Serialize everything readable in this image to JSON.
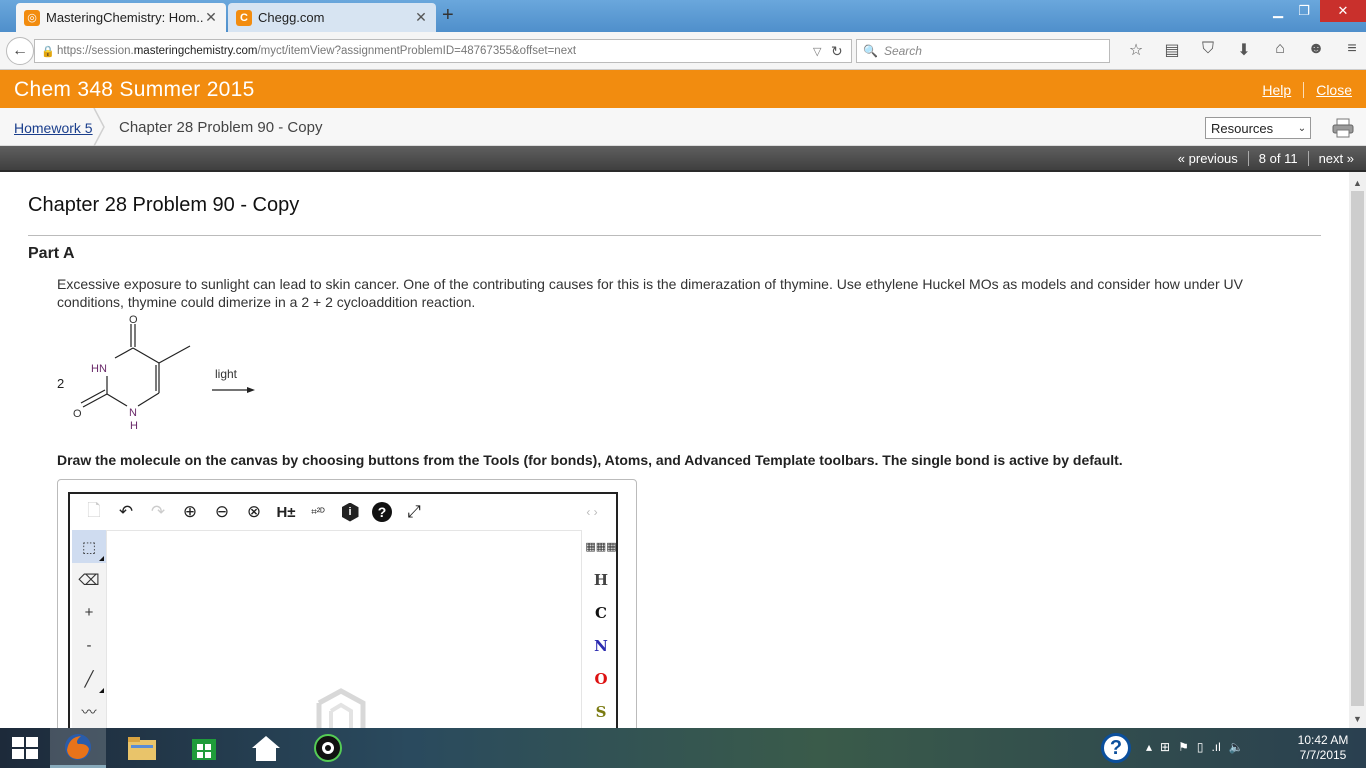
{
  "browser": {
    "tabs": [
      {
        "title": "MasteringChemistry: Hom...",
        "active": true,
        "favicon_color": "#f28c0f"
      },
      {
        "title": "Chegg.com",
        "active": false,
        "favicon_color": "#f28c0f",
        "favicon_letter": "C"
      }
    ],
    "url_prefix": "https://session.",
    "url_domain": "masteringchemistry.com",
    "url_suffix": "/myct/itemView?assignmentProblemID=48767355&offset=next",
    "search_placeholder": "Search"
  },
  "course": {
    "title": "Chem 348 Summer 2015",
    "help_label": "Help",
    "close_label": "Close",
    "accent_color": "#f28c0f"
  },
  "breadcrumb": {
    "home": "Homework 5",
    "current": "Chapter 28 Problem 90 - Copy"
  },
  "resources": {
    "selected": "Resources"
  },
  "pager": {
    "previous": "« previous",
    "position": "8 of 11",
    "next": "next »"
  },
  "problem": {
    "title": "Chapter 28 Problem 90 - Copy",
    "part": "Part A",
    "question": "Excessive exposure to sunlight can lead to skin cancer.  One of the contributing causes for this is the dimerazation of thymine.  Use ethylene Huckel MOs as models and consider how under UV conditions, thymine could dimerize in a 2 + 2 cycloaddition reaction.",
    "molecule": {
      "coefficient": "2",
      "atom_O_top": "O",
      "atom_HN": "HN",
      "atom_N": "N",
      "atom_H": "H",
      "atom_O_left": "O",
      "arrow_label": "light"
    },
    "instruction": "Draw the molecule on the canvas by choosing buttons from the Tools (for bonds), Atoms, and Advanced Template toolbars. The single bond is active by default."
  },
  "editor": {
    "top_tools": [
      {
        "name": "new-document-icon",
        "glyph": "🗋",
        "disabled": true
      },
      {
        "name": "undo-icon",
        "glyph": "↶",
        "disabled": false
      },
      {
        "name": "redo-icon",
        "glyph": "↷",
        "disabled": true
      },
      {
        "name": "zoom-in-icon",
        "glyph": "⊕",
        "disabled": false
      },
      {
        "name": "zoom-out-icon",
        "glyph": "⊖",
        "disabled": false
      },
      {
        "name": "zoom-reset-icon",
        "glyph": "⊗",
        "disabled": false
      },
      {
        "name": "hydrogen-toggle-icon",
        "glyph": "H±",
        "disabled": false
      },
      {
        "name": "clean-2d-icon",
        "glyph": "2D",
        "disabled": false
      },
      {
        "name": "info-hex-icon",
        "glyph": "i",
        "disabled": false
      },
      {
        "name": "help-icon",
        "glyph": "?",
        "disabled": false
      },
      {
        "name": "fullscreen-icon",
        "glyph": "⤢",
        "disabled": false
      }
    ],
    "left_tools": [
      {
        "name": "select-tool-icon",
        "glyph": "⬚",
        "selected": true
      },
      {
        "name": "eraser-tool-icon",
        "glyph": "⌫"
      },
      {
        "name": "increase-charge-icon",
        "glyph": "+"
      },
      {
        "name": "decrease-charge-icon",
        "glyph": "-"
      },
      {
        "name": "single-bond-tool-icon",
        "glyph": "╱"
      },
      {
        "name": "chain-tool-icon",
        "glyph": "⌇"
      }
    ],
    "atoms": [
      {
        "symbol": "H",
        "color": "#444444"
      },
      {
        "symbol": "C",
        "color": "#111111"
      },
      {
        "symbol": "N",
        "color": "#2b2bb0"
      },
      {
        "symbol": "O",
        "color": "#dd1111"
      },
      {
        "symbol": "S",
        "color": "#7a7a10"
      }
    ]
  },
  "taskbar": {
    "help_glyph": "?",
    "time": "10:42 AM",
    "date": "7/7/2015"
  }
}
